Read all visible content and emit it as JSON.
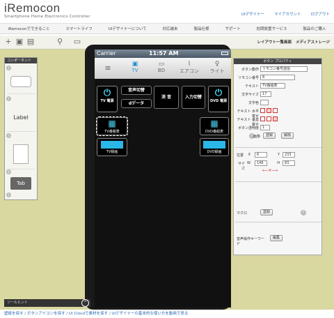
{
  "brand": {
    "name": "iRemocon",
    "tagline": "Smartphone Home Electronics Controller"
  },
  "top_links": [
    "UIデザイナー",
    "マイアカウント",
    "ログアウト"
  ],
  "nav": [
    "iRemoconでできること",
    "スマートライフ",
    "UIデザイナーについて",
    "対応端末",
    "製品仕様",
    "サポート",
    "訪問設置サービス",
    "製品のご購入"
  ],
  "toolbar": {
    "tabs": [
      "レイアウト一覧画面",
      "メディアストレージ"
    ]
  },
  "palette": {
    "title": "コンポーネント",
    "items": [
      "Label",
      "Tab"
    ],
    "numbers": [
      "1",
      "2",
      "3",
      "4",
      "5"
    ]
  },
  "phone": {
    "carrier": "Carrier",
    "time": "11:57 AM",
    "tabs": [
      "TV",
      "BD",
      "エアコン",
      "ライト"
    ],
    "buttons": {
      "tv_power": "TV 電源",
      "sound_switch": "音声切替",
      "d_data": "dデータ",
      "mute": "消 音",
      "input_switch": "入力切替",
      "dvd_power": "DVD 電源",
      "tv_program": "TV番組表",
      "dvd_program": "DVD番組表",
      "tv_record": "TV録画",
      "dvd_record": "DVD録画"
    }
  },
  "props": {
    "title": "ボタン プロパティ",
    "action_label": "ボタン動作",
    "action_value": "リモコン番号送信",
    "remote_no_label": "リモコン番号",
    "remote_no_value": "8",
    "text_label": "テキスト",
    "text_value": "TV番組表",
    "font_size_label": "文字サイズ",
    "font_size_value": "17",
    "text_color_label": "文字色",
    "h_align_label": "テキスト 水平寄せ",
    "v_align_label": "テキスト 垂直寄せ",
    "opacity_label": "ボタン透明度",
    "opacity_value": "1",
    "image_label": "画像",
    "register": "登録",
    "remove": "解除",
    "position_label": "位置",
    "x_label": "X",
    "x_value": "6",
    "y_label": "Y",
    "y_value": "233",
    "size_label": "サイズ",
    "w_label": "W",
    "w_value": "146",
    "h_label": "H",
    "h_value": "83",
    "macro_label": "マクロ",
    "macro_register": "登録",
    "voice_label": "音声操作キーワード",
    "voice_edit": "編集"
  },
  "hint": {
    "label": "ツールヒント"
  },
  "footer": "壁紙を探す / ボタンアイコンを探す / UI Cloudで素材を探す / UIデザイナーの基本的な使い方を動画で見る",
  "colors": {
    "accent": "#2a6ab0",
    "editor_bg": "#d9d8a0",
    "phone_accent": "#4bd0f0"
  }
}
